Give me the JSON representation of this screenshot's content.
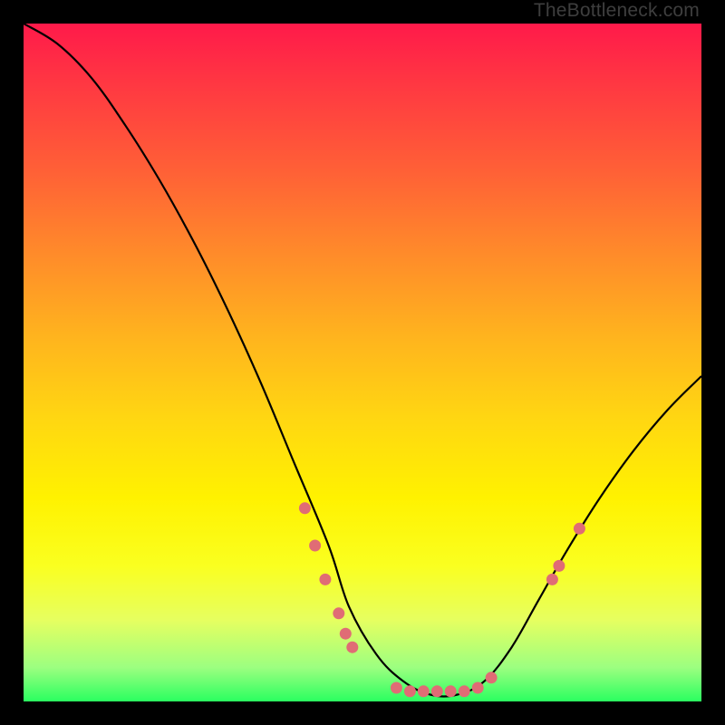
{
  "watermark": "TheBottleneck.com",
  "chart_data": {
    "type": "line",
    "title": "",
    "xlabel": "",
    "ylabel": "",
    "xlim": [
      0,
      100
    ],
    "ylim": [
      0,
      100
    ],
    "series": [
      {
        "name": "bottleneck-curve",
        "x": [
          0,
          5,
          10,
          15,
          20,
          25,
          30,
          35,
          40,
          45,
          48,
          52,
          56,
          60,
          64,
          68,
          72,
          76,
          80,
          85,
          90,
          95,
          100
        ],
        "y": [
          100,
          97,
          92,
          85,
          77,
          68,
          58,
          47,
          35,
          23,
          14,
          7,
          3,
          1,
          1,
          3,
          8,
          15,
          22,
          30,
          37,
          43,
          48
        ]
      }
    ],
    "markers": [
      {
        "x": 41.5,
        "y": 28.5
      },
      {
        "x": 43,
        "y": 23
      },
      {
        "x": 44.5,
        "y": 18
      },
      {
        "x": 46.5,
        "y": 13
      },
      {
        "x": 47.5,
        "y": 10
      },
      {
        "x": 48.5,
        "y": 8
      },
      {
        "x": 55,
        "y": 2
      },
      {
        "x": 57,
        "y": 1.5
      },
      {
        "x": 59,
        "y": 1.5
      },
      {
        "x": 61,
        "y": 1.5
      },
      {
        "x": 63,
        "y": 1.5
      },
      {
        "x": 65,
        "y": 1.5
      },
      {
        "x": 67,
        "y": 2
      },
      {
        "x": 69,
        "y": 3.5
      },
      {
        "x": 78,
        "y": 18
      },
      {
        "x": 79,
        "y": 20
      },
      {
        "x": 82,
        "y": 25.5
      }
    ],
    "marker_color": "#e06c75"
  }
}
